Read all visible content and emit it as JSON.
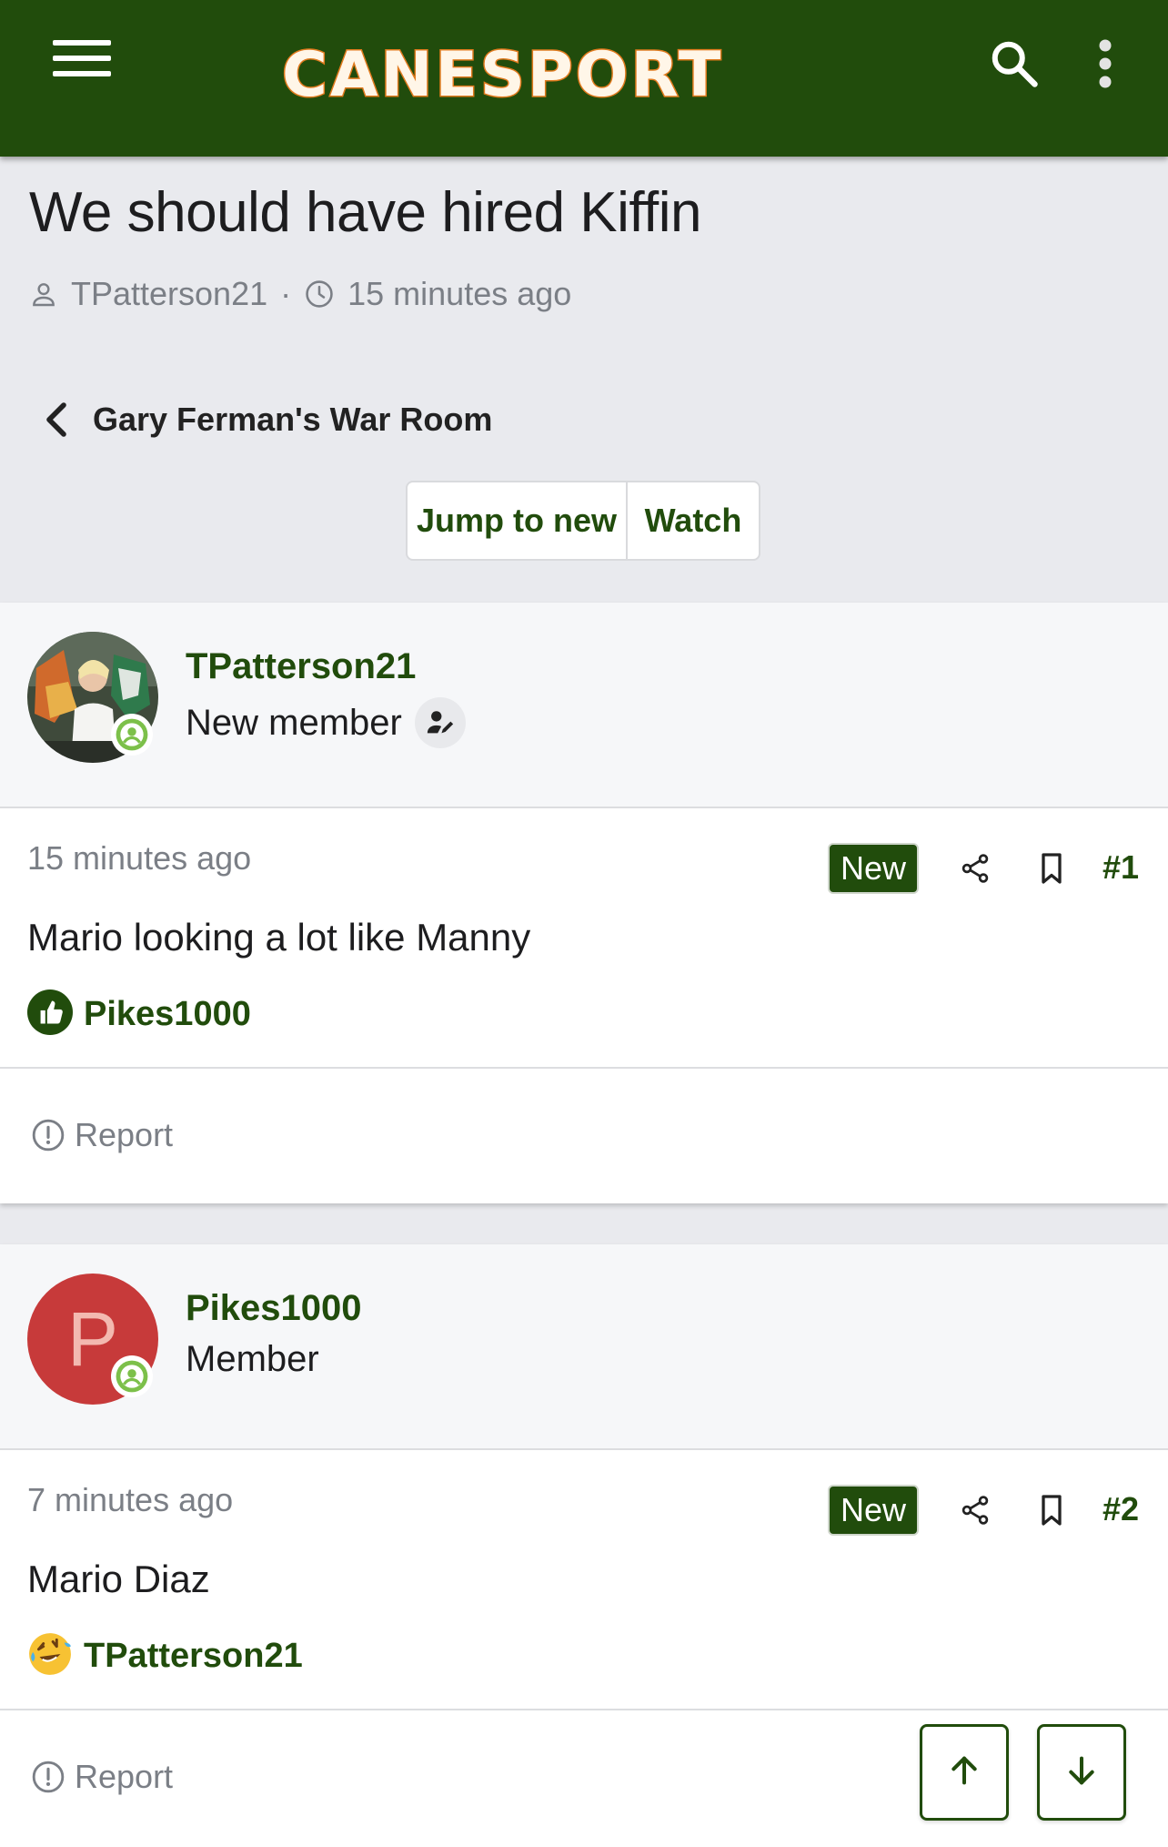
{
  "header": {
    "logo_text": "CANESPORT",
    "menu_icon": "hamburger-menu-icon",
    "search_icon": "search-icon",
    "more_icon": "vertical-ellipsis-icon",
    "brand_color": "#214c0c",
    "logo_accent": "#e07a1d"
  },
  "thread": {
    "title": "We should have hired Kiffin",
    "author": "TPatterson21",
    "separator": "·",
    "time": "15 minutes ago",
    "breadcrumb": "Gary Ferman's War Room",
    "jump_label": "Jump to new",
    "watch_label": "Watch"
  },
  "posts": [
    {
      "username": "TPatterson21",
      "user_title": "New member",
      "time": "15 minutes ago",
      "new_label": "New",
      "number": "#1",
      "text": "Mario looking a lot like Manny",
      "reaction_icon": "thumbs-up-icon",
      "reaction_user": "Pikes1000",
      "report_label": "Report"
    },
    {
      "username": "Pikes1000",
      "avatar_letter": "P",
      "avatar_color": "#c73a3a",
      "user_title": "Member",
      "time": "7 minutes ago",
      "new_label": "New",
      "number": "#2",
      "text": "Mario Diaz",
      "reaction_icon": "laughing-emoji-icon",
      "reaction_user": "TPatterson21",
      "report_label": "Report"
    }
  ],
  "nav": {
    "scroll_up_icon": "arrow-up-icon",
    "scroll_down_icon": "arrow-down-icon"
  }
}
